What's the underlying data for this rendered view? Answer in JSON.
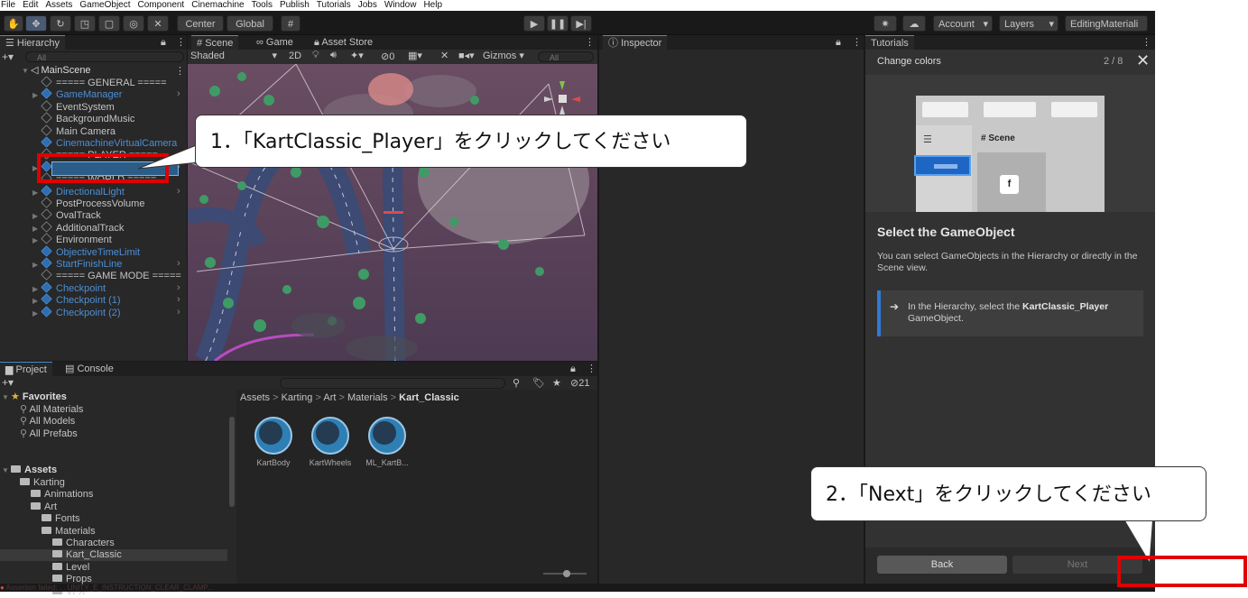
{
  "menubar": [
    "File",
    "Edit",
    "Assets",
    "GameObject",
    "Component",
    "Cinemachine",
    "Tools",
    "Publish",
    "Tutorials",
    "Jobs",
    "Window",
    "Help"
  ],
  "toolbar": {
    "pivot_label": "Center",
    "space_label": "Global",
    "account_label": "Account",
    "layers_label": "Layers",
    "layout_label": "EditingMateriali"
  },
  "hierarchy": {
    "tab_label": "Hierarchy",
    "search_placeholder": "All",
    "scene_name": "MainScene",
    "items": [
      {
        "label": "===== GENERAL =====",
        "blue": false,
        "expand": false
      },
      {
        "label": "GameManager",
        "blue": true,
        "expand": true
      },
      {
        "label": "EventSystem",
        "blue": false,
        "expand": false
      },
      {
        "label": "BackgroundMusic",
        "blue": false,
        "expand": false
      },
      {
        "label": "Main Camera",
        "blue": false,
        "expand": false
      },
      {
        "label": "CinemachineVirtualCamera",
        "blue": true,
        "expand": false
      },
      {
        "label": "===== PLAYER =====",
        "blue": false,
        "expand": false
      },
      {
        "label": "KartClassic_Player",
        "blue": true,
        "expand": true
      },
      {
        "label": "===== WORLD =====",
        "blue": false,
        "expand": false
      },
      {
        "label": "DirectionalLight",
        "blue": true,
        "expand": true
      },
      {
        "label": "PostProcessVolume",
        "blue": false,
        "expand": false
      },
      {
        "label": "OvalTrack",
        "blue": false,
        "expand": true
      },
      {
        "label": "AdditionalTrack",
        "blue": false,
        "expand": true
      },
      {
        "label": "Environment",
        "blue": false,
        "expand": true
      },
      {
        "label": "ObjectiveTimeLimit",
        "blue": true,
        "expand": false
      },
      {
        "label": "StartFinishLine",
        "blue": true,
        "expand": true
      },
      {
        "label": "===== GAME MODE =====",
        "blue": false,
        "expand": false
      },
      {
        "label": "Checkpoint",
        "blue": true,
        "expand": true
      },
      {
        "label": "Checkpoint (1)",
        "blue": true,
        "expand": true
      },
      {
        "label": "Checkpoint (2)",
        "blue": true,
        "expand": true
      }
    ]
  },
  "scene": {
    "tabs": [
      "Scene",
      "Game",
      "Asset Store"
    ],
    "shading": "Shaded",
    "mode_2d": "2D",
    "hidden_count": "0",
    "gizmos_label": "Gizmos",
    "search_placeholder": "All"
  },
  "inspector": {
    "tab_label": "Inspector"
  },
  "project": {
    "tabs": [
      "Project",
      "Console"
    ],
    "hidden_count": "21",
    "favorites_label": "Favorites",
    "favorites": [
      "All Materials",
      "All Models",
      "All Prefabs"
    ],
    "assets_label": "Assets",
    "tree": [
      {
        "label": "Karting",
        "indent": 1
      },
      {
        "label": "Animations",
        "indent": 2
      },
      {
        "label": "Art",
        "indent": 2
      },
      {
        "label": "Fonts",
        "indent": 3
      },
      {
        "label": "Materials",
        "indent": 3
      },
      {
        "label": "Characters",
        "indent": 4
      },
      {
        "label": "Kart_Classic",
        "indent": 4
      },
      {
        "label": "Level",
        "indent": 4
      },
      {
        "label": "Props",
        "indent": 4
      },
      {
        "label": "VFX",
        "indent": 4
      }
    ],
    "breadcrumb": [
      "Assets",
      "Karting",
      "Art",
      "Materials",
      "Kart_Classic"
    ],
    "assets": [
      "KartBody",
      "KartWheels",
      "ML_KartB..."
    ]
  },
  "tutorials": {
    "tab_label": "Tutorials",
    "title": "Change colors",
    "page": "2 / 8",
    "preview_scene_label": "Scene",
    "preview_key": "f",
    "heading": "Select the GameObject",
    "body": "You can select GameObjects in the Hierarchy or directly in the Scene view.",
    "instruction_prefix": "In the Hierarchy, select the ",
    "instruction_bold": "KartClassic_Player",
    "instruction_suffix": " GameObject.",
    "back_label": "Back",
    "next_label": "Next"
  },
  "statusbar": {
    "message": "Assertion failed: ... UNITY_E_INSTRUCTION_CLEAR_CLAMP..."
  },
  "callouts": {
    "step1": "1．「KartClassic_Player」をクリックしてください",
    "step2": "2．「Next」をクリックしてください"
  },
  "colors": {
    "accent": "#4c8fd6",
    "highlight": "#e00000",
    "panel": "#282828",
    "background": "#191919"
  }
}
